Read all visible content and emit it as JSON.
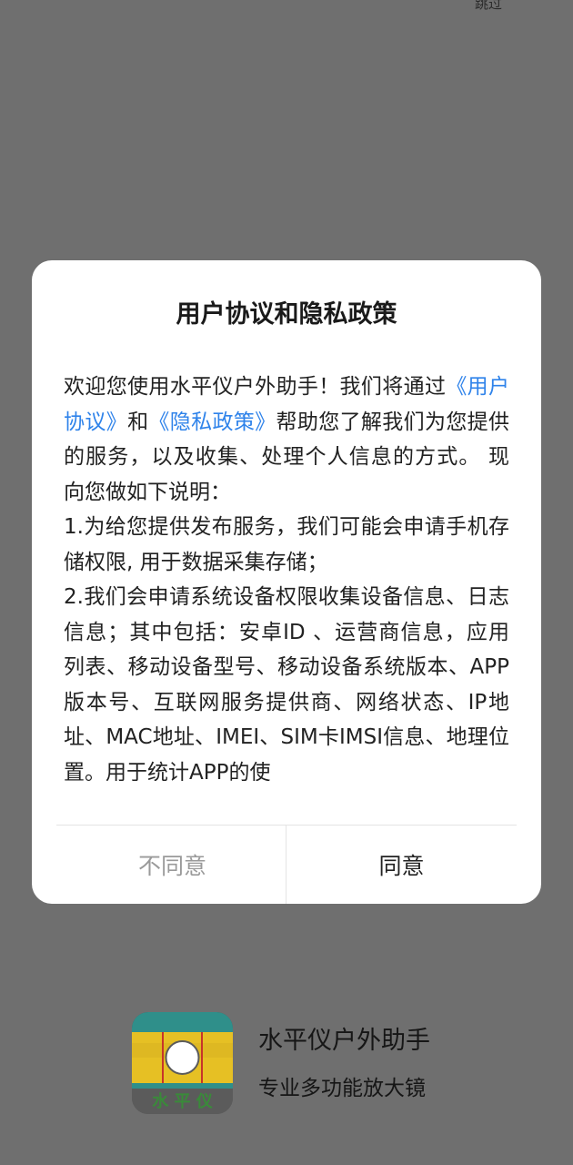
{
  "top_bar": {
    "skip_label": "跳过"
  },
  "dialog": {
    "title": "用户协议和隐私政策",
    "body": {
      "intro_prefix": "欢迎您使用水平仪户外助手！我们将通过",
      "user_agreement_link": "《用户协议》",
      "and_text": "和",
      "privacy_policy_link": "《隐私政策》",
      "intro_suffix": "帮助您了解我们为您提供的服务，以及收集、处理个人信息的方式。 现向您做如下说明：",
      "item_1": "1.为给您提供发布服务，我们可能会申请手机存储权限, 用于数据采集存储；",
      "item_2": "2.我们会申请系统设备权限收集设备信息、日志信息；其中包括：安卓ID 、运营商信息，应用列表、移动设备型号、移动设备系统版本、APP版本号、互联网服务提供商、网络状态、IP地址、MAC地址、IMEI、SIM卡IMSI信息、地理位置。用于统计APP的使"
    },
    "buttons": {
      "disagree": "不同意",
      "agree": "同意"
    }
  },
  "splash": {
    "app_name": "水平仪户外助手",
    "slogan": "专业多功能放大镜",
    "icon_text": "水 平 仪"
  },
  "colors": {
    "overlay_background": "#6f6f6f",
    "link_blue": "#2f83ea",
    "icon_teal": "#2f8f8a",
    "icon_yellow": "#e6c024",
    "icon_red": "#c7342a"
  }
}
